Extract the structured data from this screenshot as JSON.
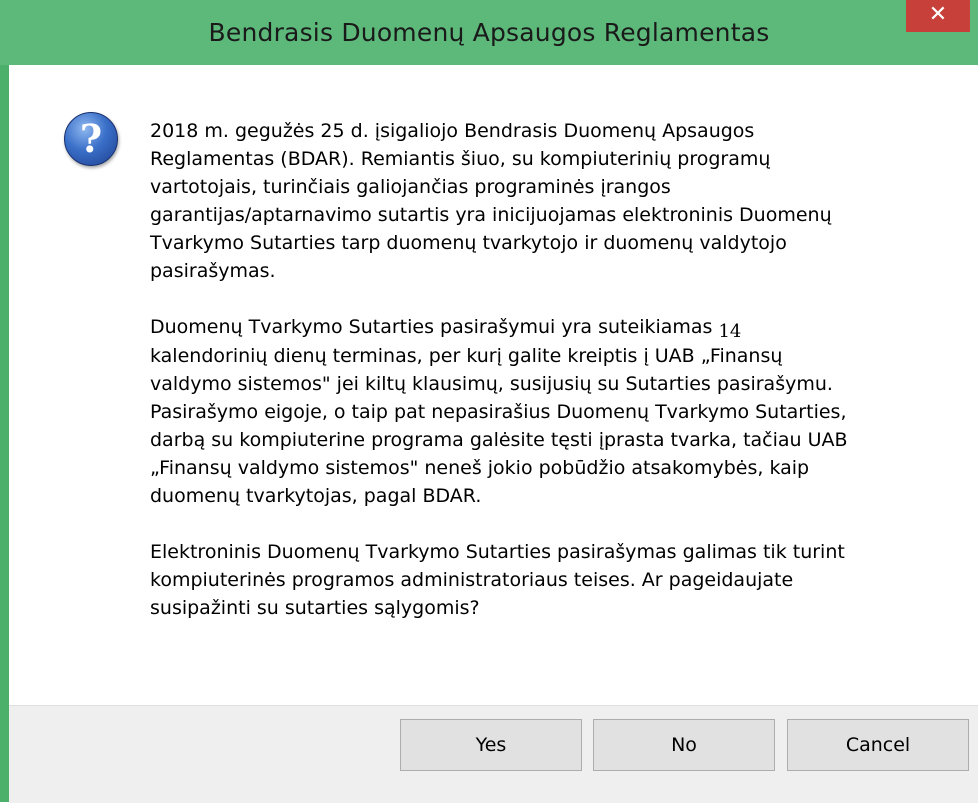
{
  "window": {
    "title": "Bendrasis Duomenų Apsaugos Reglamentas",
    "close_glyph": "✕",
    "accent_color": "#5cb97a",
    "close_color": "#c7413a"
  },
  "icon": {
    "name": "question-icon",
    "glyph": "?"
  },
  "message": {
    "paragraph1": "2018 m. gegužės 25 d. įsigaliojo Bendrasis Duomenų Apsaugos Reglamentas (BDAR). Remiantis šiuo, su kompiuterinių programų vartotojais, turinčiais galiojančias programinės įrangos garantijas/aptarnavimo sutartis yra inicijuojamas elektroninis Duomenų Tvarkymo Sutarties tarp duomenų tvarkytojo ir duomenų valdytojo pasirašymas.",
    "paragraph2_start": "Duomenų Tvarkymo Sutarties pasirašymui yra suteikiamas",
    "paragraph2_days": "14",
    "paragraph2_end": "kalendorinių dienų terminas, per kurį galite kreiptis į UAB „Finansų valdymo sistemos\" jei kiltų klausimų, susijusių su Sutarties pasirašymu. Pasirašymo eigoje, o taip pat nepasirašius Duomenų Tvarkymo Sutarties, darbą su kompiuterine programa galėsite tęsti įprasta tvarka, tačiau UAB „Finansų valdymo sistemos\" neneš jokio pobūdžio atsakomybės, kaip duomenų tvarkytojas, pagal BDAR.",
    "paragraph3": "Elektroninis Duomenų Tvarkymo Sutarties pasirašymas galimas tik turint kompiuterinės programos administratoriaus teises. Ar pageidaujate susipažinti su sutarties sąlygomis?"
  },
  "buttons": {
    "yes": "Yes",
    "no": "No",
    "cancel": "Cancel"
  }
}
